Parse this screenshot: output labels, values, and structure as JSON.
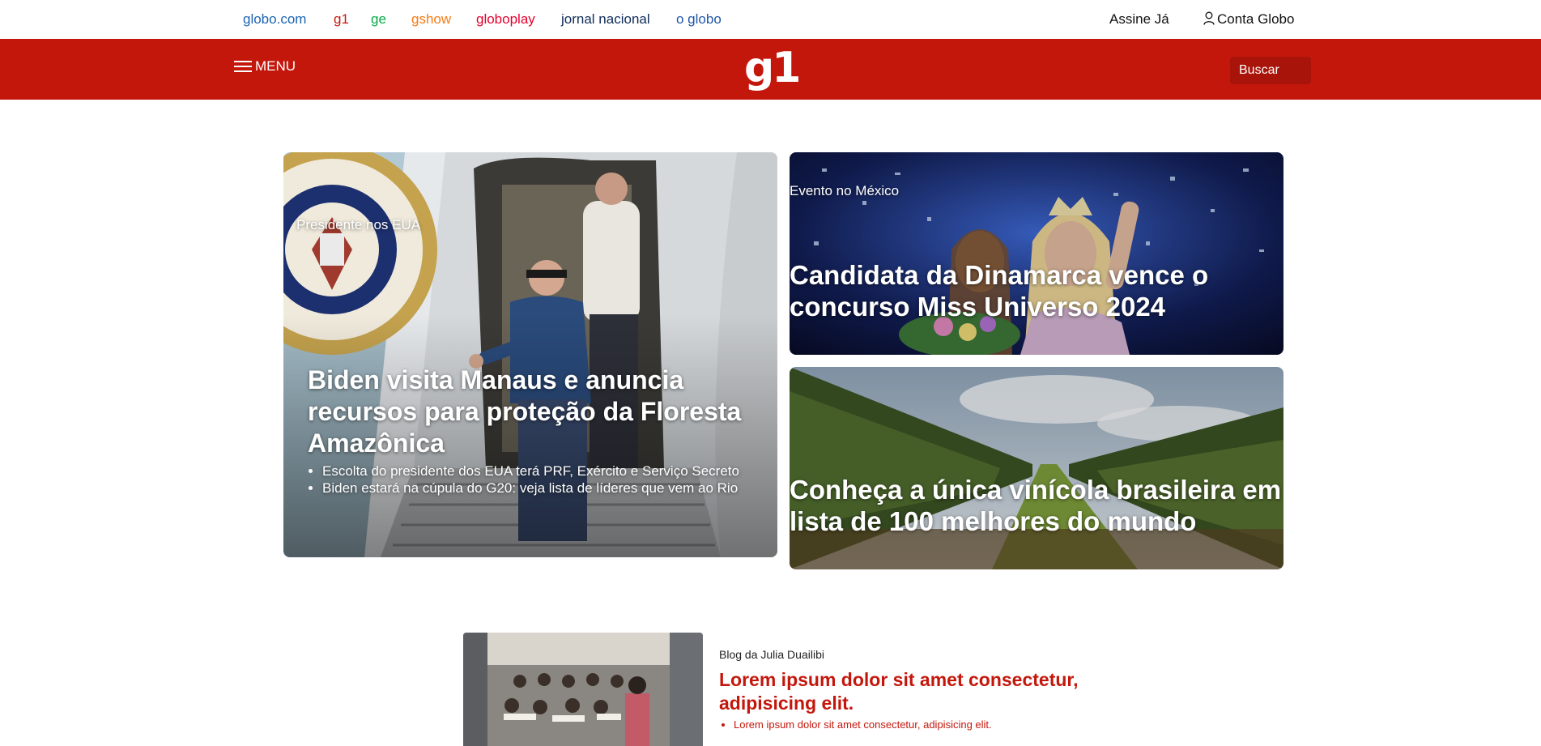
{
  "topbar": {
    "links": [
      {
        "label": "globo.com",
        "color": "#1c64b4"
      },
      {
        "label": "g1",
        "color": "#c4170c"
      },
      {
        "label": "ge",
        "color": "#06aa48"
      },
      {
        "label": "gshow",
        "color": "#f87b14"
      },
      {
        "label": "globoplay",
        "color": "#e6002c"
      },
      {
        "label": "jornal nacional",
        "color": "#0f2c5a"
      },
      {
        "label": "o globo",
        "color": "#1f56a8"
      }
    ],
    "subscribe_label": "Assine Já",
    "account_label": "Conta Globo"
  },
  "header": {
    "menu_label": "MENU",
    "logo_text": "g1",
    "search_label": "Buscar",
    "brand_color": "#c4170c"
  },
  "featured": {
    "main": {
      "eyebrow": "Presidente nos EUA",
      "title": "Biden visita Manaus e anuncia recursos para proteção da Floresta Amazônica",
      "bullets": [
        "Escolta do presidente dos EUA terá PRF, Exército e Serviço Secreto",
        "Biden estará na cúpula do G20: veja lista de líderes que vem ao Rio"
      ]
    },
    "side_top": {
      "eyebrow": "Evento no México",
      "title": "Candidata da Dinamarca vence o concurso Miss Universo 2024"
    },
    "side_bottom": {
      "title": "Conheça a única vinícola brasileira em lista de 100 melhores do mundo"
    }
  },
  "blog": {
    "section": "Blog da Julia Duailibi",
    "title": "Lorem ipsum dolor sit amet consectetur, adipisicing elit.",
    "bullets": [
      "Lorem ipsum dolor sit amet consectetur, adipisicing elit."
    ]
  }
}
